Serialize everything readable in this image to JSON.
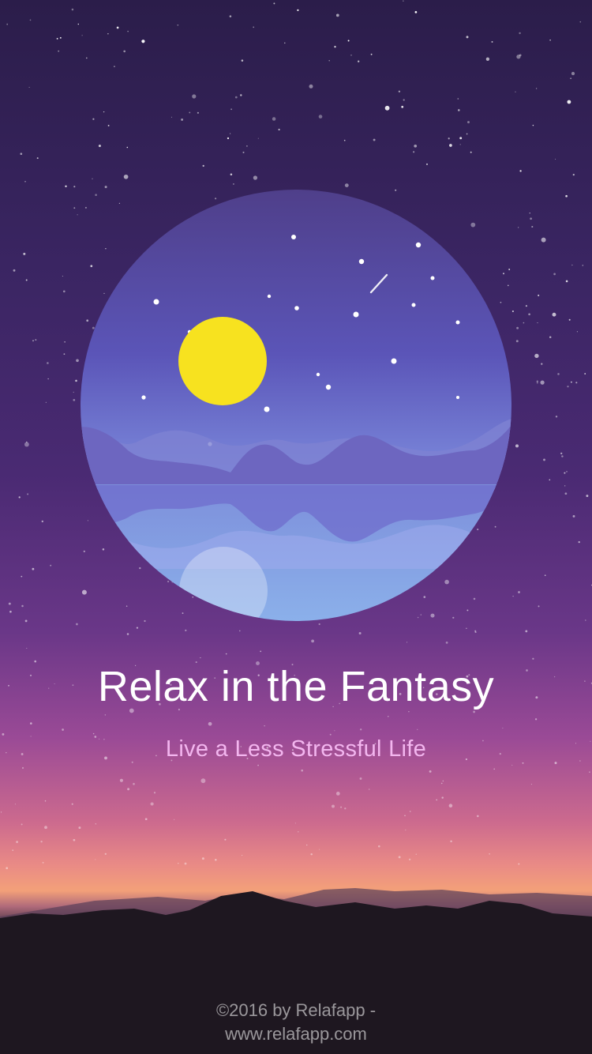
{
  "screen": {
    "title": "Relax in the Fantasy",
    "subtitle": "Live a Less Stressful Life",
    "copyright_line": "©2016 by Relafapp -",
    "website_line": "www.relafapp.com"
  },
  "colors": {
    "title": "#ffffff",
    "subtitle": "#f3b6ef",
    "moon": "#f7e21f",
    "emblem_sky": "#5a4fb0",
    "emblem_water": "#8aa8e6"
  }
}
